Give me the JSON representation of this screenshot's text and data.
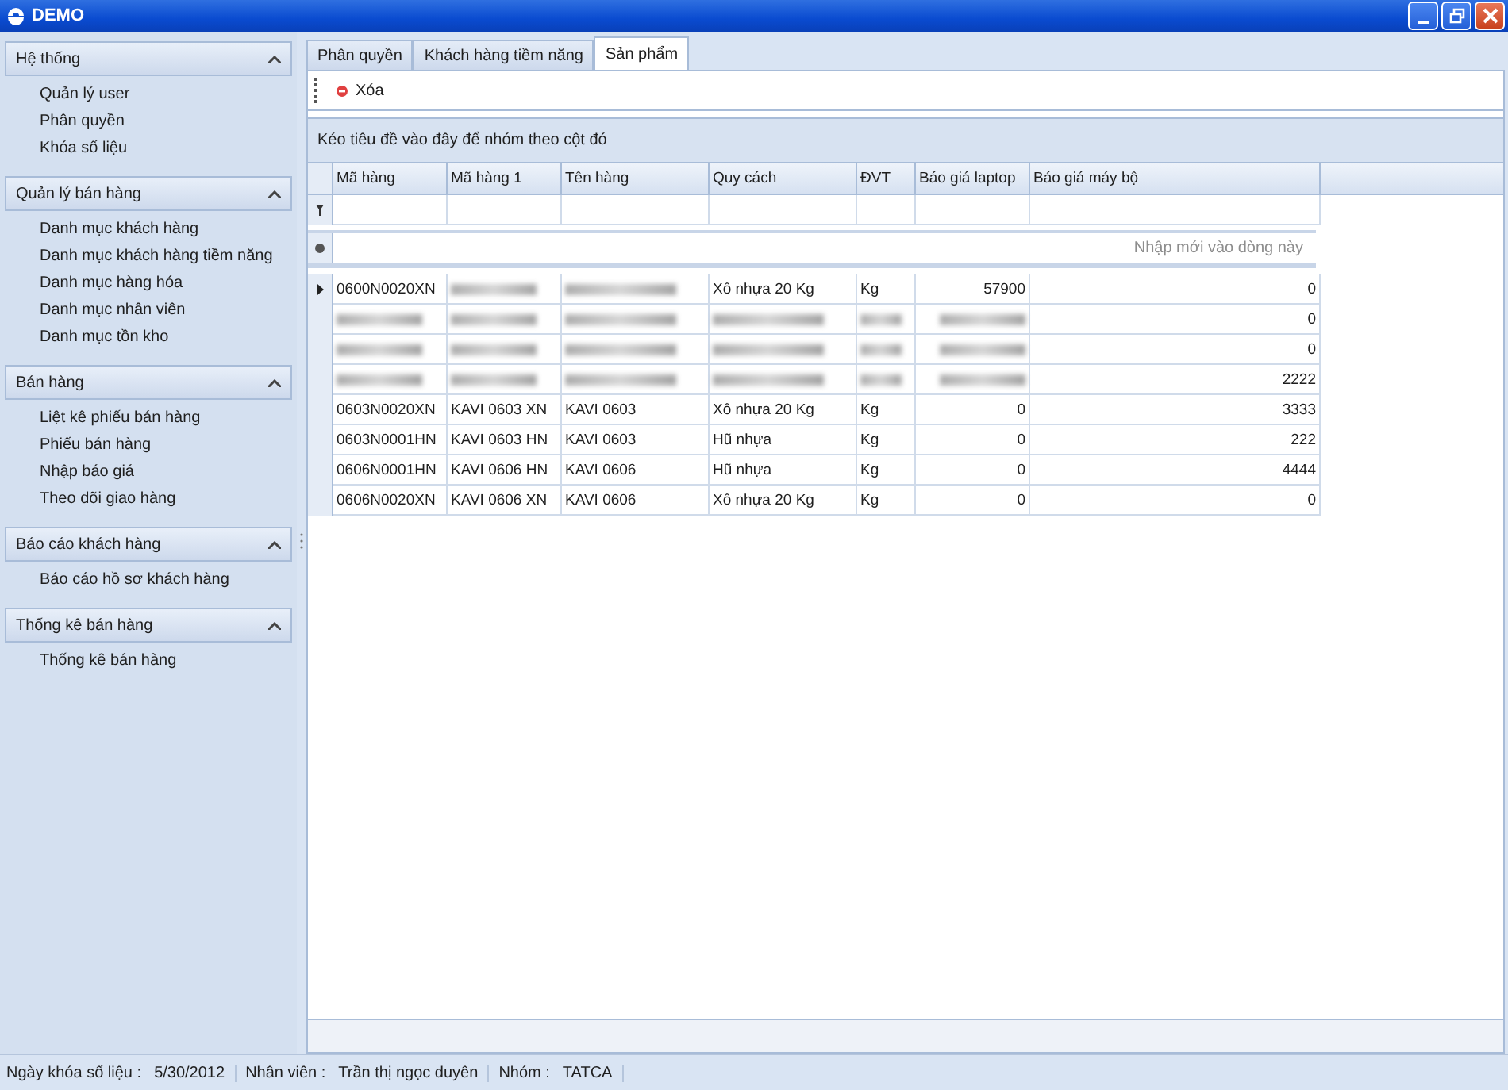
{
  "window": {
    "title": "DEMO"
  },
  "sidebar": {
    "groups": [
      {
        "title": "Hệ thống",
        "expanded": true,
        "items": [
          "Quản lý user",
          "Phân quyền",
          "Khóa số liệu"
        ]
      },
      {
        "title": "Quản lý bán hàng",
        "expanded": true,
        "items": [
          "Danh mục khách hàng",
          "Danh mục khách hàng tiềm năng",
          "Danh mục hàng hóa",
          "Danh mục nhân viên",
          "Danh mục tồn kho"
        ]
      },
      {
        "title": "Bán hàng",
        "expanded": true,
        "items": [
          "Liệt kê phiếu bán hàng",
          "Phiếu bán hàng",
          "Nhập báo giá",
          "Theo dõi giao hàng"
        ]
      },
      {
        "title": "Báo cáo khách hàng",
        "expanded": true,
        "items": [
          "Báo cáo hồ sơ khách hàng"
        ]
      },
      {
        "title": "Thống kê bán hàng",
        "expanded": true,
        "items": [
          "Thống kê bán hàng"
        ]
      }
    ]
  },
  "tabs": [
    {
      "label": "Phân quyền",
      "selected": false
    },
    {
      "label": "Khách hàng tiềm năng",
      "selected": false
    },
    {
      "label": "Sản phẩm",
      "selected": true
    }
  ],
  "toolbar": {
    "buttons": [
      {
        "label": "Xóa",
        "kind": "delete"
      }
    ]
  },
  "grid": {
    "group_panel": "Kéo tiêu đề vào đây để nhóm theo cột đó",
    "columns": [
      "Mã hàng",
      "Mã hàng 1",
      "Tên hàng",
      "Quy cách",
      "ĐVT",
      "Báo giá laptop",
      "Báo giá máy bộ"
    ],
    "new_row_placeholder": "Nhập mới vào dòng này",
    "rows": [
      {
        "current": true,
        "cells": [
          "0600N0020XN",
          null,
          null,
          "Xô nhựa 20 Kg",
          "Kg",
          "57900",
          "0"
        ]
      },
      {
        "current": false,
        "cells": [
          null,
          null,
          null,
          null,
          null,
          null,
          "0"
        ]
      },
      {
        "current": false,
        "cells": [
          null,
          null,
          null,
          null,
          null,
          null,
          "0"
        ]
      },
      {
        "current": false,
        "cells": [
          null,
          null,
          null,
          null,
          null,
          null,
          "2222"
        ]
      },
      {
        "current": false,
        "cells": [
          "0603N0020XN",
          "KAVI 0603 XN",
          "KAVI 0603",
          "Xô nhựa 20 Kg",
          "Kg",
          "0",
          "3333"
        ]
      },
      {
        "current": false,
        "cells": [
          "0603N0001HN",
          "KAVI 0603 HN",
          "KAVI 0603",
          "Hũ nhựa",
          "Kg",
          "0",
          "222"
        ]
      },
      {
        "current": false,
        "cells": [
          "0606N0001HN",
          "KAVI 0606 HN",
          "KAVI 0606",
          "Hũ nhựa",
          "Kg",
          "0",
          "4444"
        ]
      },
      {
        "current": false,
        "cells": [
          "0606N0020XN",
          "KAVI 0606 XN",
          "KAVI 0606",
          "Xô nhựa 20 Kg",
          "Kg",
          "0",
          "0"
        ]
      }
    ]
  },
  "status_bar": [
    {
      "label": "Ngày khóa số liệu :",
      "value": "5/30/2012"
    },
    {
      "label": "Nhân viên :",
      "value": "Trần thị ngọc duyên"
    },
    {
      "label": "Nhóm :",
      "value": "TATCA"
    }
  ]
}
